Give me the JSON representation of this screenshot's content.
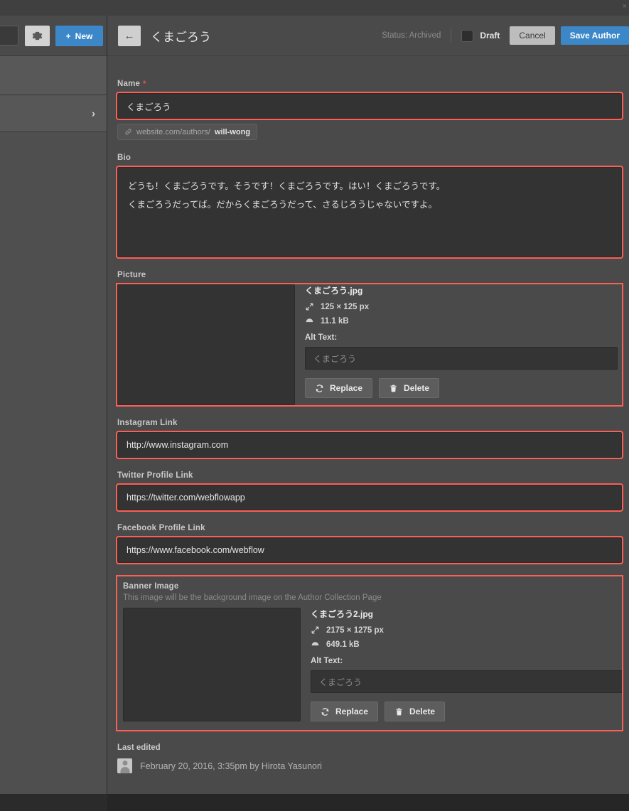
{
  "window": {
    "close_glyph": "×"
  },
  "left_panel": {
    "gear_icon": "gear-icon",
    "new_button": "New",
    "new_plus": "+",
    "chevron": "›"
  },
  "header": {
    "back_arrow": "←",
    "title": "くまごろう",
    "status": "Status: Archived",
    "draft_label": "Draft",
    "cancel_label": "Cancel",
    "save_label": "Save Author"
  },
  "fields": {
    "name": {
      "label": "Name",
      "required_mark": "*",
      "value": "くまごろう",
      "slug_prefix": "website.com/authors/",
      "slug_value": "will-wong",
      "slug_icon": "link-icon"
    },
    "bio": {
      "label": "Bio",
      "line1": "どうも！くまごろうです。そうです！くまごろうです。はい！くまごろうです。",
      "line2": "くまごろうだってば。だからくまごろうだって、さるじろうじゃないですよ。"
    },
    "picture": {
      "label": "Picture",
      "file_name": "くまごろう.jpg",
      "dimensions": "125 × 125 px",
      "file_size": "11.1 kB",
      "alt_label": "Alt Text:",
      "alt_placeholder": "くまごろう",
      "replace_label": "Replace",
      "delete_label": "Delete"
    },
    "instagram": {
      "label": "Instagram Link",
      "value": "http://www.instagram.com"
    },
    "twitter": {
      "label": "Twitter Profile Link",
      "value": "https://twitter.com/webflowapp"
    },
    "facebook": {
      "label": "Facebook Profile Link",
      "value": "https://www.facebook.com/webflow"
    },
    "banner": {
      "label": "Banner Image",
      "help": "This image will be the background image on the Author Collection Page",
      "file_name": "くまごろう2.jpg",
      "dimensions": "2175 × 1275 px",
      "file_size": "649.1 kB",
      "alt_label": "Alt Text:",
      "alt_placeholder": "くまごろう",
      "replace_label": "Replace",
      "delete_label": "Delete"
    }
  },
  "last_edited": {
    "label": "Last edited",
    "value": "February 20, 2016, 3:35pm by Hirota Yasunori"
  },
  "colors": {
    "accent_blue": "#3b87c8",
    "highlight_red": "#fc5f55",
    "panel_bg": "#4a4a4a",
    "input_bg": "#333333"
  }
}
